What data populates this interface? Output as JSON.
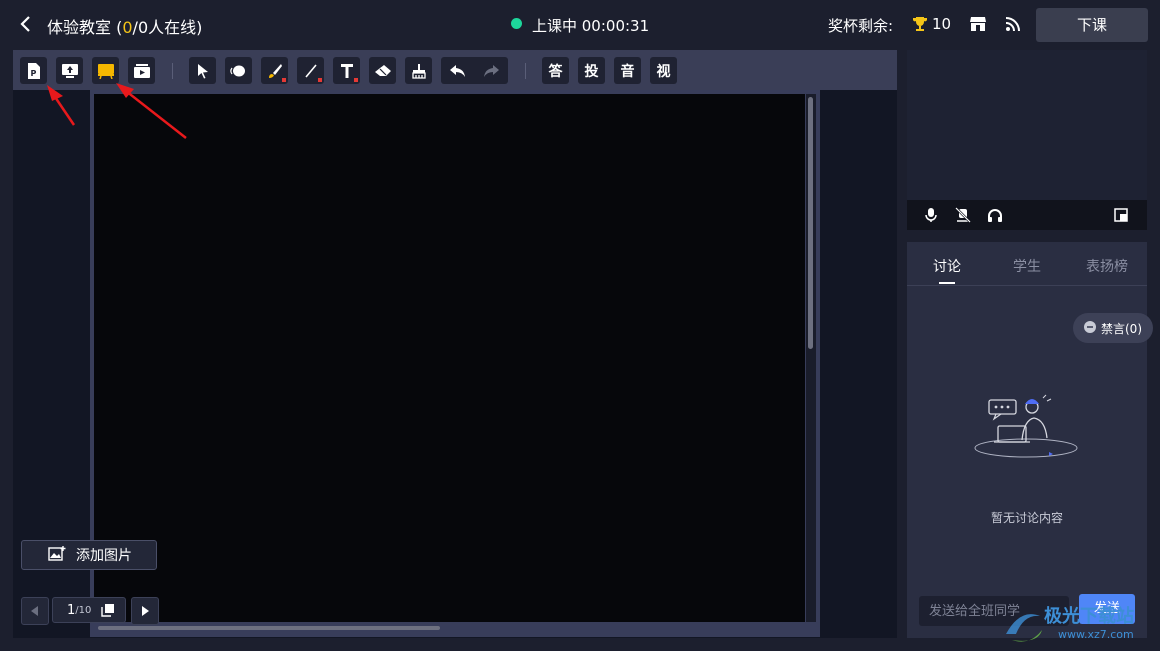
{
  "header": {
    "title": "体验教室",
    "online_open": "(",
    "online_count": "0",
    "online_rest": "/0人在线)",
    "status": "上课中 00:00:31",
    "trophy_label": "奖杯剩余:",
    "trophy_count": "10",
    "end_class": "下课"
  },
  "toolbar": {
    "text_tools": {
      "answer": "答",
      "vote": "投",
      "audio": "音",
      "video": "视"
    }
  },
  "board": {
    "add_image": "添加图片",
    "page_current": "1",
    "page_total": "/10"
  },
  "chat": {
    "tabs": [
      "讨论",
      "学生",
      "表扬榜"
    ],
    "mute_all": "禁言(0)",
    "empty": "暂无讨论内容",
    "input_placeholder": "发送给全班同学",
    "send": "发送"
  },
  "watermark": {
    "text": "极光下载站",
    "sub": "www.xz7.com"
  },
  "colors": {
    "accent": "#4f86f7",
    "live": "#1dd69b",
    "highlight": "#f5c518",
    "annotation": "#e8191c"
  }
}
